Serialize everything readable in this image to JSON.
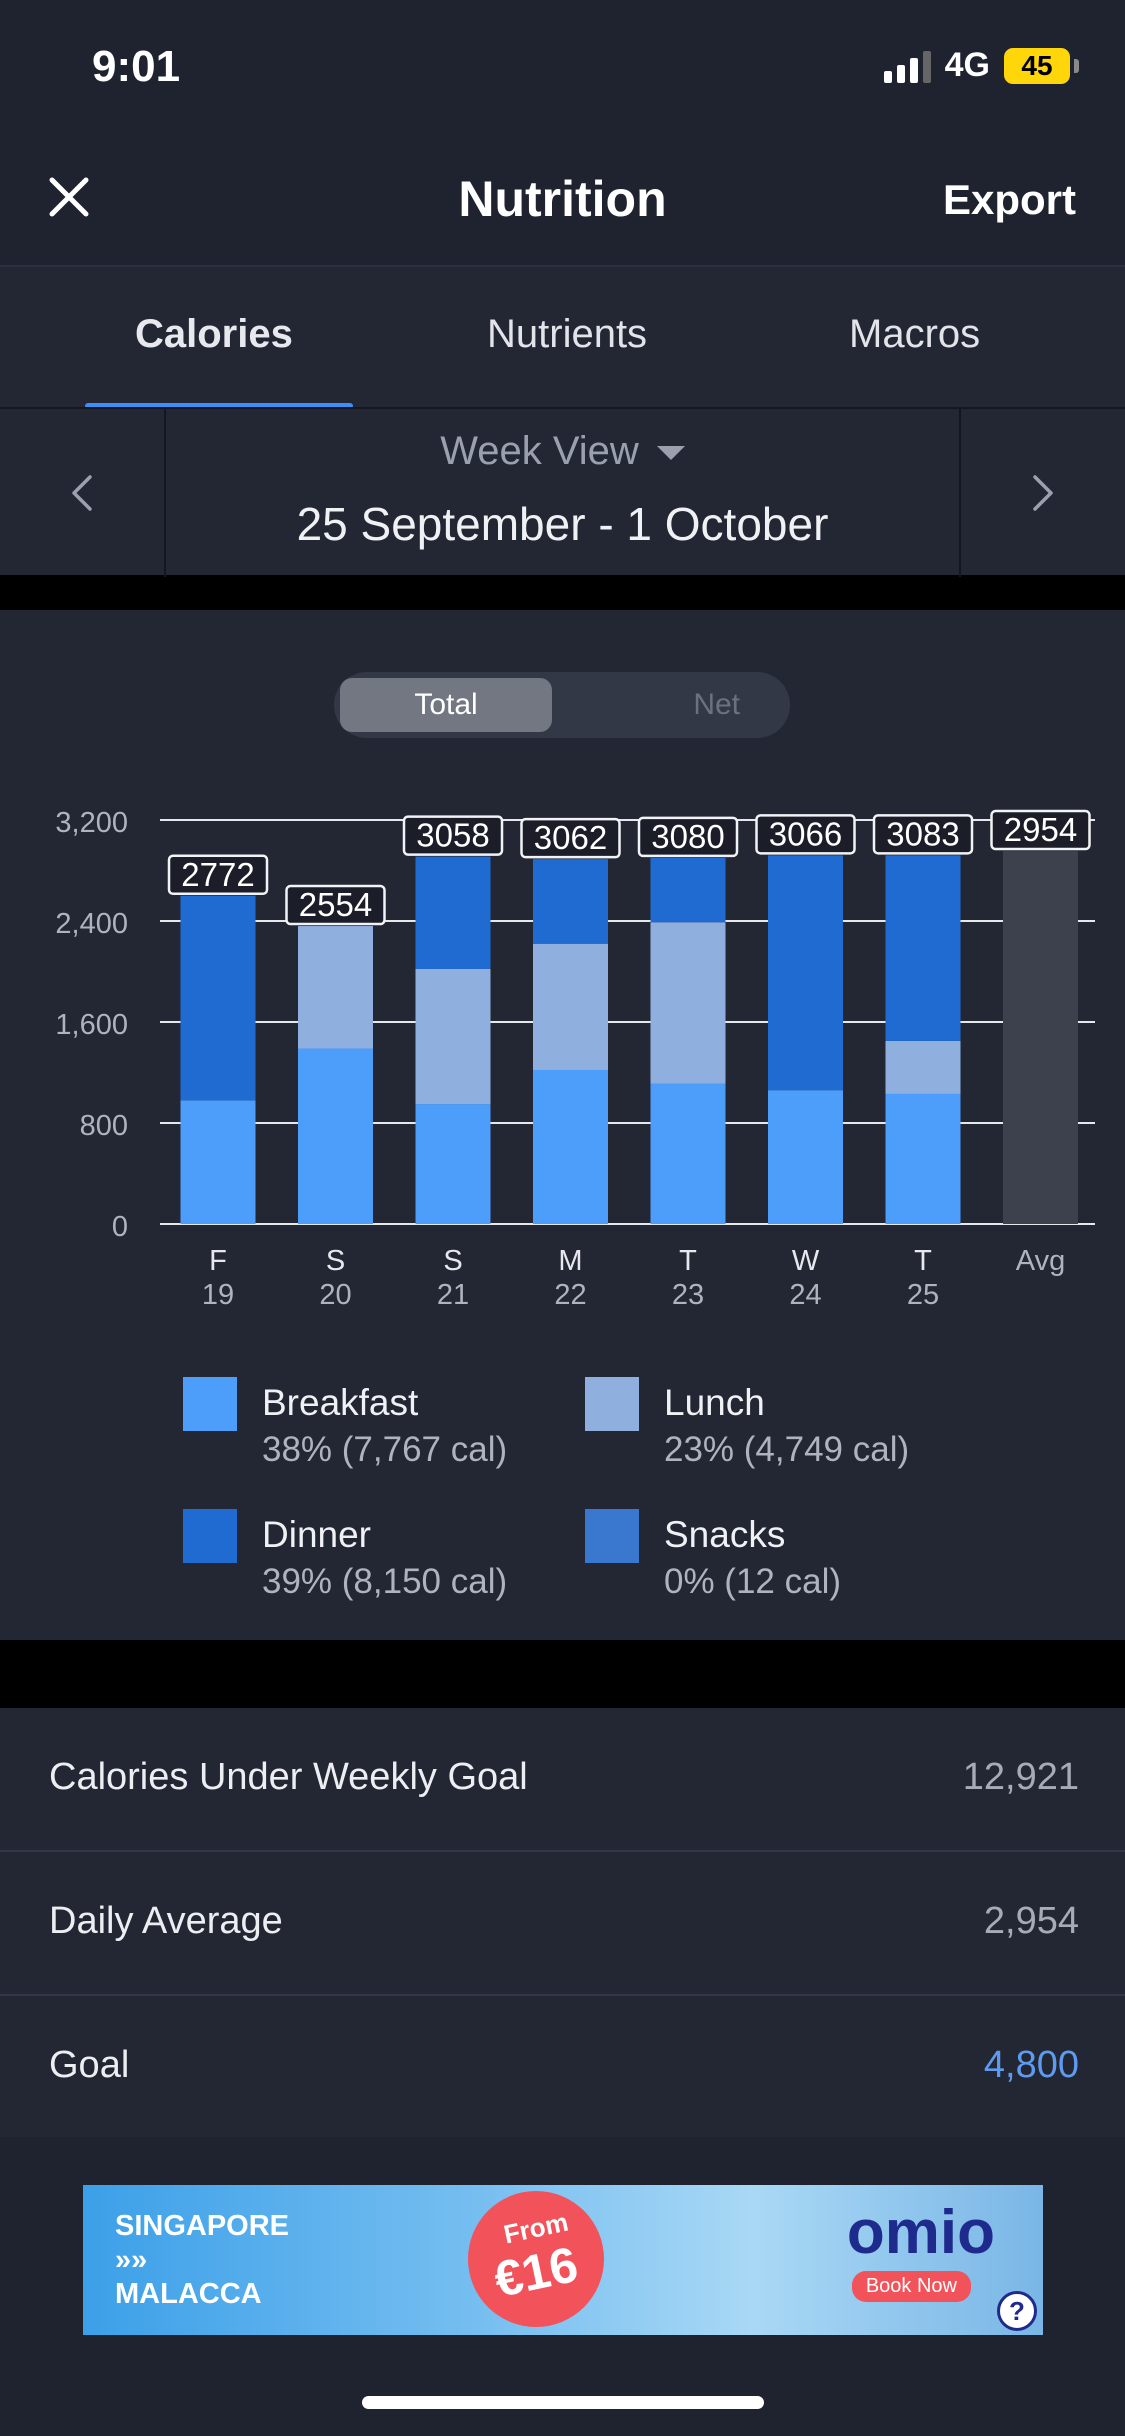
{
  "status_bar": {
    "time": "9:01",
    "network": "4G",
    "battery": "45"
  },
  "nav": {
    "title": "Nutrition",
    "export_label": "Export"
  },
  "tabs": [
    {
      "label": "Calories",
      "active": true
    },
    {
      "label": "Nutrients",
      "active": false
    },
    {
      "label": "Macros",
      "active": false
    }
  ],
  "week": {
    "view_label": "Week View",
    "range": "25 September - 1 October"
  },
  "toggle": {
    "total_label": "Total",
    "net_label": "Net",
    "selected": "Total"
  },
  "chart_data": {
    "type": "bar",
    "stacked": true,
    "categories": [
      "F",
      "S",
      "S",
      "M",
      "T",
      "W",
      "T",
      "Avg"
    ],
    "category_dates": [
      "19",
      "20",
      "21",
      "22",
      "23",
      "24",
      "25",
      ""
    ],
    "series": [
      {
        "name": "Breakfast",
        "color": "#4d9dfa",
        "values": [
          980,
          1390,
          950,
          1220,
          1110,
          1060,
          1030,
          0
        ]
      },
      {
        "name": "Lunch",
        "color": "#8fb0df",
        "values": [
          0,
          970,
          1070,
          1000,
          1280,
          0,
          420,
          0
        ]
      },
      {
        "name": "Dinner",
        "color": "#1f6bd1",
        "values": [
          1620,
          0,
          890,
          670,
          510,
          1860,
          1470,
          0
        ]
      },
      {
        "name": "Snacks",
        "color": "#3a78cf",
        "values": [
          0,
          0,
          0,
          0,
          0,
          0,
          0,
          0
        ]
      },
      {
        "name": "Avg",
        "color": "#3d414d",
        "values": [
          0,
          0,
          0,
          0,
          0,
          0,
          0,
          2954
        ]
      }
    ],
    "totals": [
      "2772",
      "2554",
      "3058",
      "3062",
      "3080",
      "3066",
      "3083",
      "2954"
    ],
    "yticks": [
      "3,200",
      "2,400",
      "1,600",
      "800",
      "0"
    ],
    "ylim": [
      0,
      3200
    ],
    "grid": true
  },
  "legend": [
    {
      "name": "Breakfast",
      "detail": "38% (7,767 cal)",
      "color": "#4d9dfa"
    },
    {
      "name": "Lunch",
      "detail": "23% (4,749 cal)",
      "color": "#8fb0df"
    },
    {
      "name": "Dinner",
      "detail": "39% (8,150 cal)",
      "color": "#1f6bd1"
    },
    {
      "name": "Snacks",
      "detail": "0% (12 cal)",
      "color": "#3a78cf"
    }
  ],
  "stats": [
    {
      "label": "Calories Under Weekly Goal",
      "value": "12,921",
      "accent": false
    },
    {
      "label": "Daily Average",
      "value": "2,954",
      "accent": false
    },
    {
      "label": "Goal",
      "value": "4,800",
      "accent": true
    }
  ],
  "ad": {
    "destination_top": "SINGAPORE",
    "destination_arrow": "»»",
    "destination_bottom": "MALACCA",
    "from_label": "From",
    "price": "€16",
    "brand": "omio",
    "cta": "Book Now",
    "help": "?"
  }
}
